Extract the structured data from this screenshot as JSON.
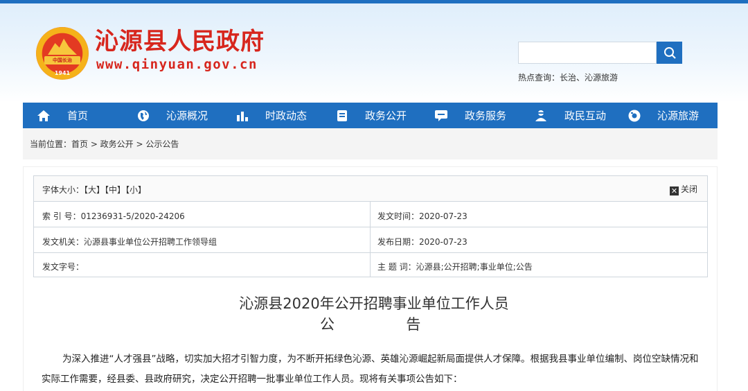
{
  "header": {
    "site_name": "沁源县人民政府",
    "site_url": "www.qinyuan.gov.cn",
    "emblem_band": "中国长治",
    "emblem_year": "1941",
    "search_placeholder": "",
    "hot_search": "热点查询：长治、沁源旅游"
  },
  "nav": {
    "items": [
      {
        "label": "首页",
        "icon": "home-icon"
      },
      {
        "label": "沁源概况",
        "icon": "globe-icon"
      },
      {
        "label": "时政动态",
        "icon": "bar-chart-icon"
      },
      {
        "label": "政务公开",
        "icon": "document-icon"
      },
      {
        "label": "政务服务",
        "icon": "chat-icon"
      },
      {
        "label": "政民互动",
        "icon": "users-icon"
      },
      {
        "label": "沁源旅游",
        "icon": "camera-icon"
      }
    ]
  },
  "breadcrumb": "当前位置：首页 > 政务公开 > 公示公告",
  "meta": {
    "font_size_label": "字体大小：【大】【中】【小】",
    "close_label": "关闭",
    "index_no": "索  引  号：01236931-5/2020-24206",
    "issue_time": "发文时间：2020-07-23",
    "issuer": "发文机关：沁源县事业单位公开招聘工作领导组",
    "publish_date": "发布日期：2020-07-23",
    "doc_no": "发文字号：",
    "keywords": "主  题  词：沁源县;公开招聘;事业单位;公告"
  },
  "article": {
    "title": "沁源县2020年公开招聘事业单位工作人员",
    "subtitle_1": "公",
    "subtitle_2": "告",
    "paragraph": "为深入推进“人才强县”战略，切实加大招才引智力度，为不断开拓绿色沁源、英雄沁源崛起新局面提供人才保障。根据我县事业单位编制、岗位空缺情况和实际工作需要，经县委、县政府研究，决定公开招聘一批事业单位工作人员。现将有关事项公告如下："
  },
  "colors": {
    "brand_blue": "#1f6fc0",
    "brand_red": "#d7261d"
  }
}
